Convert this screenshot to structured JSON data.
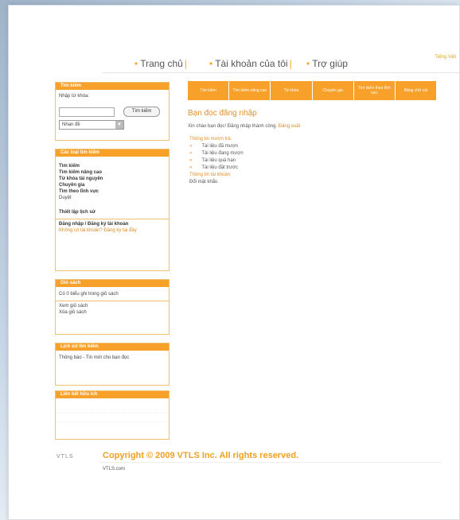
{
  "nav": {
    "items": [
      "Trang chủ",
      "Tài khoản của tôi",
      "Trợ giúp"
    ],
    "separator": "|",
    "top_right": "Tiếng Việt"
  },
  "login_box": {
    "header": "Tìm kiếm",
    "label": "Nhập từ khóa:",
    "input_value": "",
    "button": "Tìm kiếm",
    "select_value": "Nhan đề"
  },
  "search_box": {
    "header": "Các loại tìm kiếm",
    "links": [
      "Tìm kiếm",
      "Tìm kiếm nâng cao",
      "Từ khóa tài nguyên",
      "Chuyên gia",
      "Tìm theo lĩnh vực",
      "Duyệt"
    ],
    "extra": "Thiết lập lịch sử",
    "note_title": "Đăng nhập / Đăng ký tài khoản",
    "note_text": "Không có tài khoản? Đăng ký tại đây"
  },
  "cart_box": {
    "header": "Giỏ sách",
    "line1": "Có 0 biểu ghi trong giỏ sách",
    "line2": "Xem giỏ sách",
    "line3": "Xóa giỏ sách"
  },
  "info_box": {
    "header": "Lịch sử tìm kiếm",
    "text": "Thông báo - Tin mới cho bạn đọc"
  },
  "links_box": {
    "header": "Liên kết hữu ích",
    "lines": [
      "",
      ""
    ]
  },
  "tabs": [
    "Tìm kiếm",
    "Tìm kiếm nâng cao",
    "Từ khóa",
    "Chuyên gia",
    "Tìm kiếm theo lĩnh vực",
    "Bảng chữ cái"
  ],
  "content": {
    "title": "Bạn đọc đăng nhập",
    "welcome": "Xin chào bạn đọc! Đăng nhập thành công.",
    "welcome_link": "Đăng xuất",
    "section1": "Thông tin mượn trả:",
    "items": [
      "Tài liệu đã mượn",
      "Tài liệu đang mượn",
      "Tài liệu quá hạn",
      "Tài liệu đặt trước"
    ],
    "bullet": "»",
    "section2": "Thông tin tài khoản:",
    "account": "Đổi mật khẩu"
  },
  "footer": {
    "logo": "VTLS",
    "copyright": "Copyright © 2009 VTLS Inc. All rights reserved.",
    "site": "VTLS.com"
  }
}
